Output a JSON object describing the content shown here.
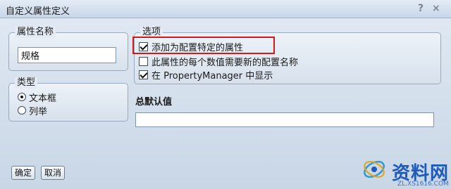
{
  "window": {
    "title": "自定义属性定义",
    "help_glyph": "?",
    "close_glyph": "×"
  },
  "property_name": {
    "label": "属性名称",
    "value": "规格"
  },
  "type_group": {
    "label": "类型",
    "options": [
      {
        "label": "文本框",
        "selected": true
      },
      {
        "label": "列举",
        "selected": false
      }
    ]
  },
  "options_group": {
    "label": "选项",
    "items": [
      {
        "label": "添加为配置特定的属性",
        "checked": true
      },
      {
        "label": "此属性的每个数值需要新的配置名称",
        "checked": false
      },
      {
        "label": "在 PropertyManager 中显示",
        "checked": true
      }
    ]
  },
  "default_value": {
    "label": "总默认值",
    "value": ""
  },
  "buttons": {
    "ok": "确定",
    "cancel": "取消"
  },
  "watermark": {
    "brand": "资料网",
    "site": "ZL.XS1616.COM"
  },
  "colors": {
    "highlight": "#d11b1b",
    "watermark": "#1e5bb8"
  }
}
